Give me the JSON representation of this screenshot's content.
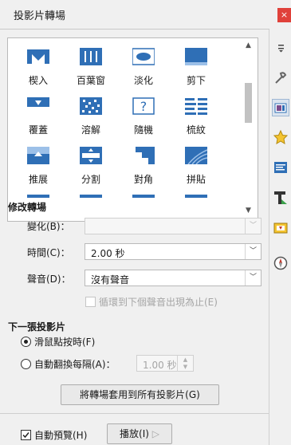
{
  "window": {
    "title": "投影片轉場",
    "close_label": "×"
  },
  "gallery": {
    "items": [
      {
        "label": "楔入",
        "icon": "wedge-icon"
      },
      {
        "label": "百葉窗",
        "icon": "venetian-icon"
      },
      {
        "label": "淡化",
        "icon": "fade-icon"
      },
      {
        "label": "剪下",
        "icon": "cut-icon"
      },
      {
        "label": "覆蓋",
        "icon": "cover-icon"
      },
      {
        "label": "溶解",
        "icon": "dissolve-icon"
      },
      {
        "label": "隨機",
        "icon": "random-icon"
      },
      {
        "label": "梳紋",
        "icon": "comb-icon"
      },
      {
        "label": "推展",
        "icon": "push-icon"
      },
      {
        "label": "分割",
        "icon": "split-icon"
      },
      {
        "label": "對角",
        "icon": "diagonal-icon"
      },
      {
        "label": "拼貼",
        "icon": "tiles-icon"
      }
    ],
    "random_glyph": "?"
  },
  "modify": {
    "heading": "修改轉場",
    "variant_label": "變化(B)：",
    "variant_value": "",
    "duration_label": "時間(C)：",
    "duration_value": "2.00 秒",
    "sound_label": "聲音(D)：",
    "sound_value": "沒有聲音",
    "loop_label": "循環到下個聲音出現為止(E)"
  },
  "advance": {
    "heading": "下一張投影片",
    "on_click_label": "滑鼠點按時(F)",
    "auto_label": "自動翻換每隔(A)：",
    "auto_value": "1.00 秒"
  },
  "apply_all_label": "將轉場套用到所有投影片(G)",
  "footer": {
    "auto_preview_label": "自動預覽(H)",
    "play_label": "播放(I)",
    "play_glyph": "▷"
  },
  "sidebar": {
    "items": [
      "menu-icon",
      "properties-icon",
      "slide-transition-icon",
      "gallery-star-icon",
      "master-slides-icon",
      "styles-icon",
      "animation-icon",
      "navigator-icon"
    ]
  },
  "colors": {
    "accent": "#2f6fb6",
    "close": "#e0413a"
  }
}
